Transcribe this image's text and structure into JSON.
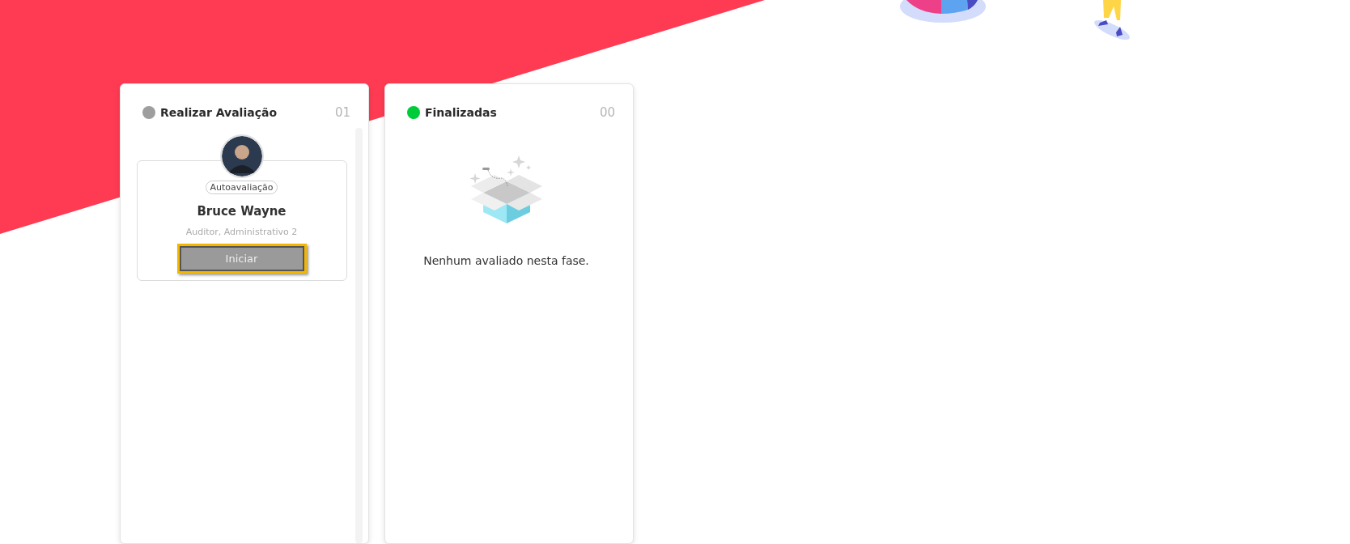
{
  "columns": [
    {
      "title": "Realizar Avaliação",
      "count": "01",
      "color": "#9e9e9e",
      "scrollable": true,
      "cards": [
        {
          "tag": "Autoavaliação",
          "name": "Bruce Wayne",
          "role": "Auditor, Administrativo 2",
          "button": {
            "label": "Iniciar",
            "focused": true
          }
        }
      ]
    },
    {
      "title": "Finalizadas",
      "count": "00",
      "color": "#00cc3a",
      "scrollable": false,
      "empty_message": "Nenhum avaliado nesta fase."
    }
  ]
}
